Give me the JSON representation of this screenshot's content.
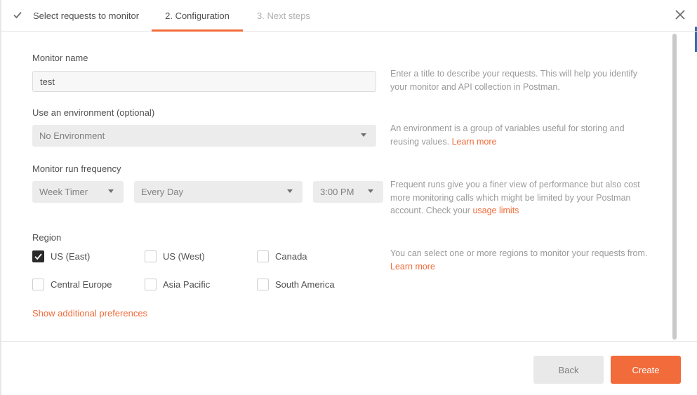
{
  "stepper": {
    "steps": [
      {
        "label": "Select requests to monitor",
        "state": "done"
      },
      {
        "label": "2. Configuration",
        "state": "active"
      },
      {
        "label": "3. Next steps",
        "state": "pending"
      }
    ]
  },
  "form": {
    "monitor_name": {
      "label": "Monitor name",
      "value": "test",
      "help": "Enter a title to describe your requests. This will help you identify your monitor and API collection in Postman."
    },
    "environment": {
      "label": "Use an environment (optional)",
      "selected": "No Environment",
      "help": "An environment is a group of variables useful for storing and reusing values.",
      "help_link": "Learn more"
    },
    "frequency": {
      "label": "Monitor run frequency",
      "timer_type": "Week Timer",
      "day": "Every Day",
      "time": "3:00 PM",
      "help": "Frequent runs give you a finer view of performance but also cost more monitoring calls which might be limited by your Postman account. Check your",
      "help_link": "usage limits"
    },
    "region": {
      "label": "Region",
      "options": [
        {
          "label": "US (East)",
          "checked": true
        },
        {
          "label": "US (West)",
          "checked": false
        },
        {
          "label": "Canada",
          "checked": false
        },
        {
          "label": "Central Europe",
          "checked": false
        },
        {
          "label": "Asia Pacific",
          "checked": false
        },
        {
          "label": "South America",
          "checked": false
        }
      ],
      "help": "You can select one or more regions to monitor your requests from.",
      "help_link": "Learn more"
    },
    "show_additional": "Show additional preferences"
  },
  "footer": {
    "back_label": "Back",
    "create_label": "Create"
  },
  "colors": {
    "accent": "#f26b3a",
    "checked_box": "#2a2a2a"
  }
}
